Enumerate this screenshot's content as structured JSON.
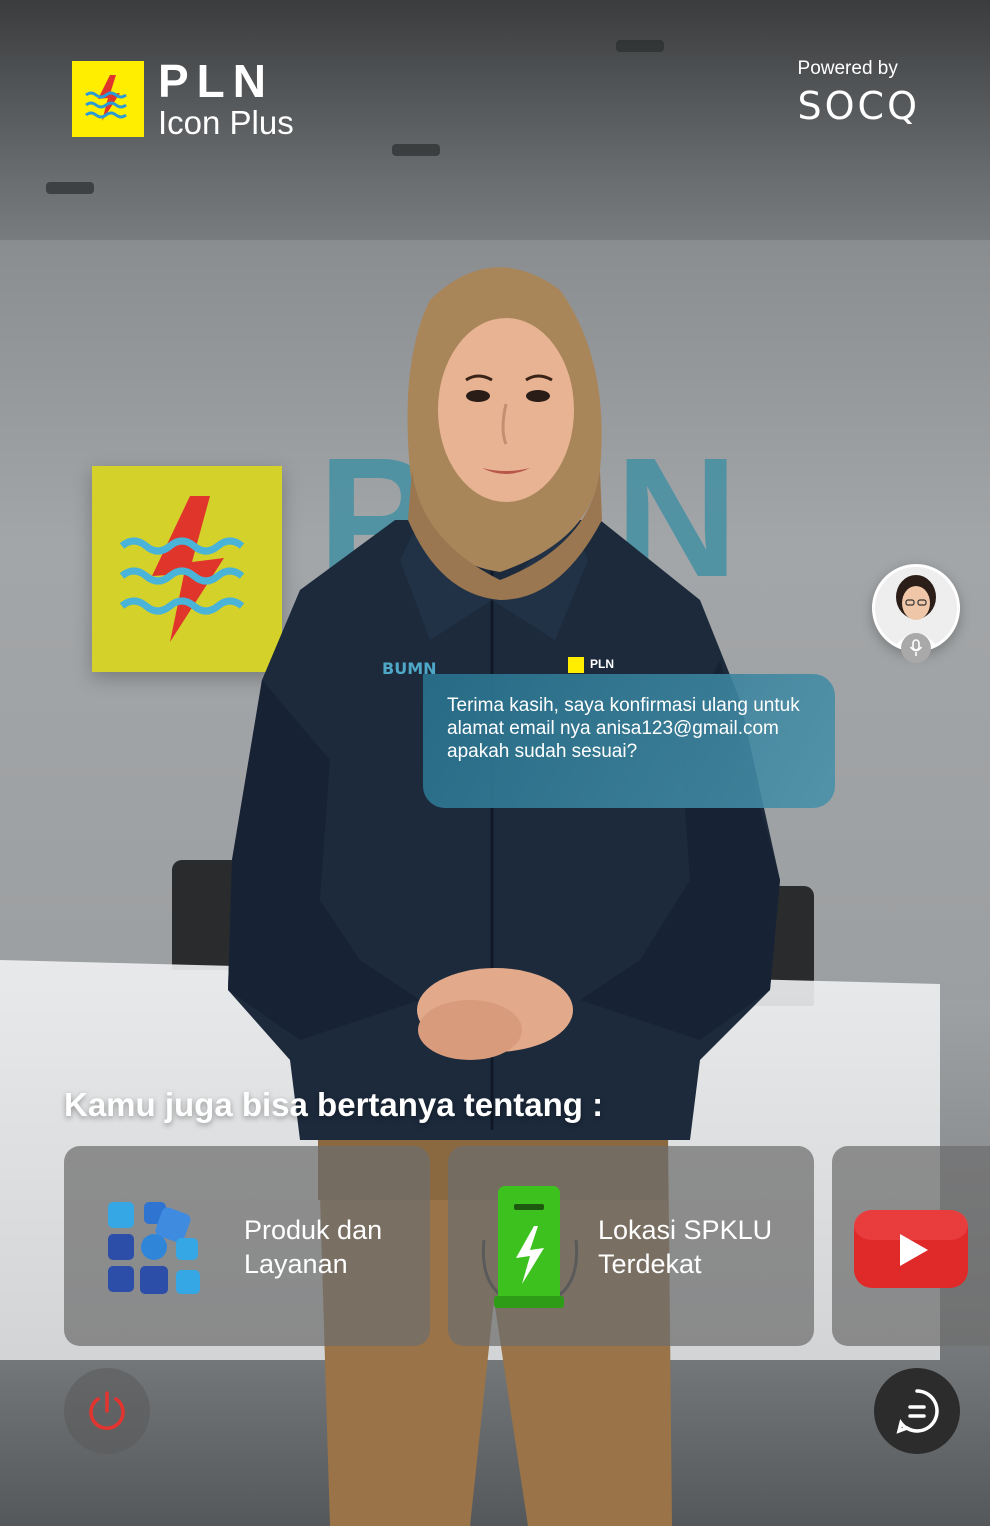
{
  "header": {
    "brand_name": "PLN",
    "brand_sub": "Icon Plus",
    "powered_label": "Powered by",
    "powered_logo": "SOCQ"
  },
  "background": {
    "wall_logo_text": "PLN"
  },
  "uniform": {
    "badge_left": "BUMN",
    "badge_right": "PLN"
  },
  "chat": {
    "bubble_text": "Terima kasih, saya konfirmasi ulang untuk alamat email nya anisa123@gmail.com apakah sudah sesuai?",
    "user_avatar": "user-avatar",
    "mic_icon": "microphone-icon"
  },
  "suggestions": {
    "title": "Kamu juga bisa bertanya tentang :",
    "cards": [
      {
        "label_line1": "Produk dan",
        "label_line2": "Layanan",
        "icon": "grid-apps-icon"
      },
      {
        "label_line1": "Lokasi SPKLU",
        "label_line2": "Terdekat",
        "icon": "ev-charger-icon"
      },
      {
        "icon": "youtube-play-icon"
      }
    ]
  },
  "controls": {
    "power_icon": "power-icon",
    "chat_icon": "chat-icon"
  },
  "colors": {
    "brand_yellow": "#ffee00",
    "bubble": "#2f7a96",
    "power_red": "#e3342f",
    "charger_green": "#3cc11e",
    "youtube_red": "#e02a2a"
  }
}
